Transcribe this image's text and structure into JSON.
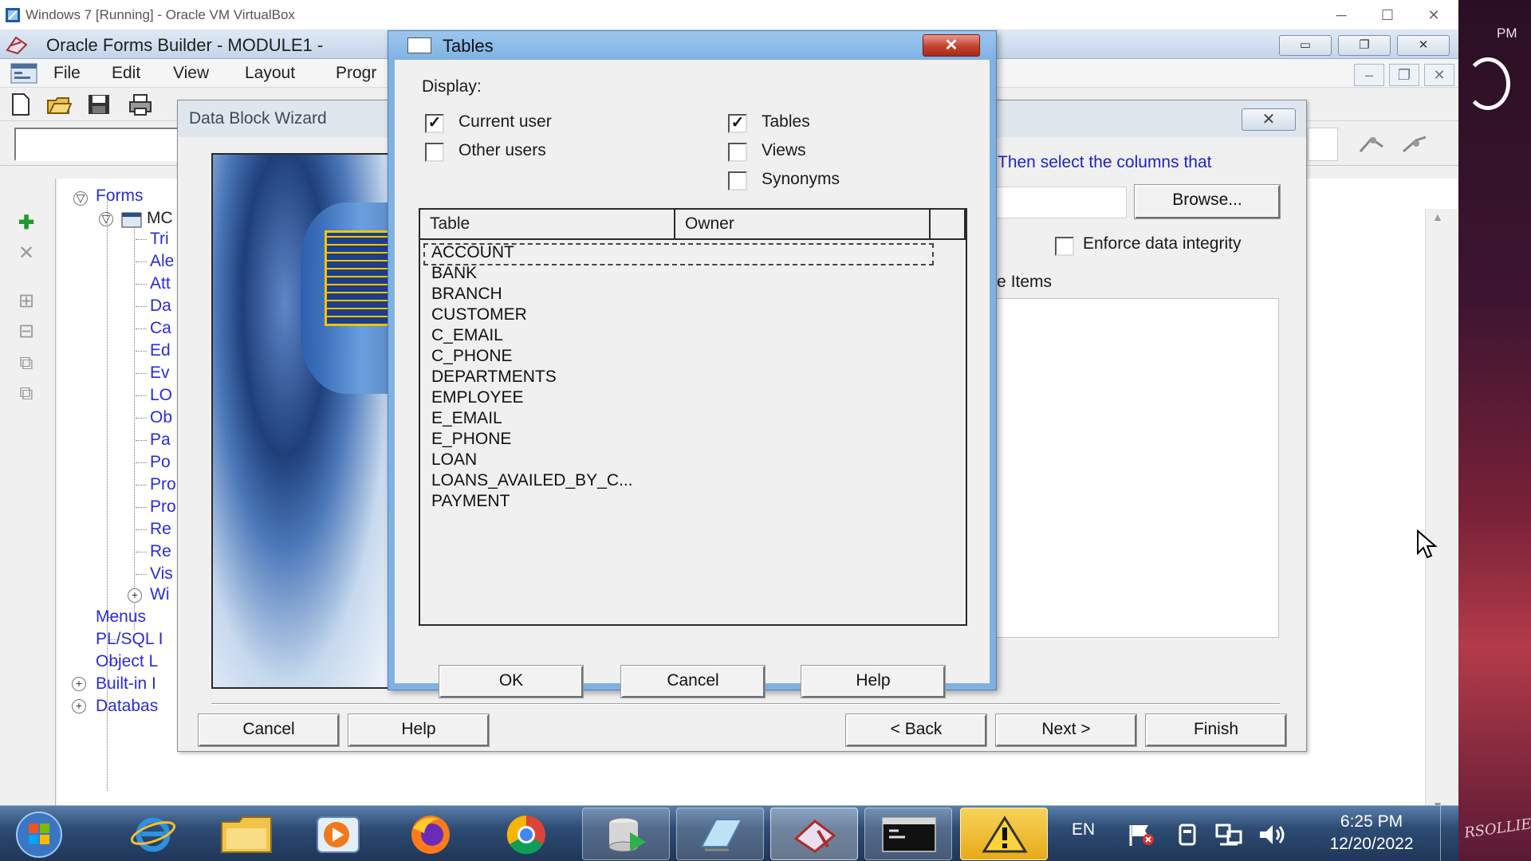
{
  "vbox": {
    "title": "Windows 7 [Running] - Oracle VM VirtualBox",
    "controls": [
      "─",
      "☐",
      "✕"
    ]
  },
  "forms": {
    "title": "Oracle Forms Builder - MODULE1 -",
    "menu": [
      "File",
      "Edit",
      "View",
      "Layout",
      "Progr"
    ]
  },
  "navigator": {
    "root": "Forms",
    "module": "MC",
    "module_children": [
      "Tri",
      "Ale",
      "Att",
      "Da",
      "Ca",
      "Ed",
      "Ev",
      "LO",
      "Ob",
      "Pa",
      "Po",
      "Pro",
      "Pro",
      "Re",
      "Re",
      "Vis",
      "Wi"
    ],
    "top_level": [
      "Menus",
      "PL/SQL I",
      "Object L",
      "Built-in I",
      "Databas"
    ]
  },
  "wizard": {
    "title": "Data Block Wizard",
    "instruction": "Then select the columns that",
    "browse_label": "Browse...",
    "enforce_label": "Enforce data integrity",
    "db_items_label": "ase Items",
    "buttons": {
      "cancel": "Cancel",
      "help": "Help",
      "back": "< Back",
      "next": "Next >",
      "finish": "Finish"
    }
  },
  "tables_dialog": {
    "title": "Tables",
    "display_label": "Display:",
    "options": {
      "current_user": {
        "label": "Current user",
        "checked": true
      },
      "other_users": {
        "label": "Other users",
        "checked": false
      },
      "tables": {
        "label": "Tables",
        "checked": true
      },
      "views": {
        "label": "Views",
        "checked": false
      },
      "synonyms": {
        "label": "Synonyms",
        "checked": false
      }
    },
    "columns": [
      "Table",
      "Owner"
    ],
    "rows": [
      "ACCOUNT",
      "BANK",
      "BRANCH",
      "CUSTOMER",
      "C_EMAIL",
      "C_PHONE",
      "DEPARTMENTS",
      "EMPLOYEE",
      "E_EMAIL",
      "E_PHONE",
      "LOAN",
      "LOANS_AVAILED_BY_C...",
      "PAYMENT"
    ],
    "buttons": {
      "ok": "OK",
      "cancel": "Cancel",
      "help": "Help"
    }
  },
  "taskbar": {
    "language": "EN",
    "time": "6:25 PM",
    "date": "12/20/2022"
  },
  "wallpaper": {
    "time_fragment": "PM",
    "signature": "RSOLLIER"
  }
}
